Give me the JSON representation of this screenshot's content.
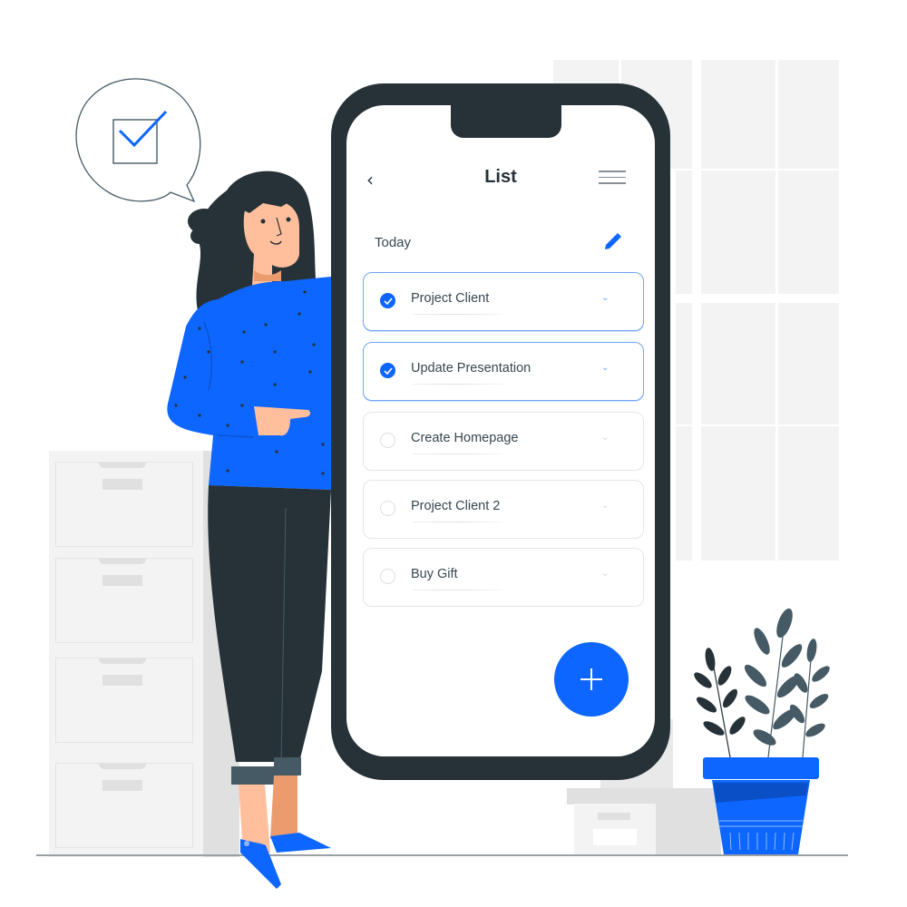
{
  "app": {
    "header": {
      "back_icon": "chevron-left-icon",
      "back_glyph": "‹",
      "title": "List",
      "menu_icon": "hamburger-menu-icon"
    },
    "section": {
      "label": "Today",
      "edit_icon": "pencil-icon"
    },
    "tasks": [
      {
        "label": "Project Client",
        "completed": true
      },
      {
        "label": "Update Presentation",
        "completed": true
      },
      {
        "label": "Create Homepage",
        "completed": false
      },
      {
        "label": "Project Client 2",
        "completed": false
      },
      {
        "label": "Buy Gift",
        "completed": false
      }
    ],
    "chevron_glyph": "⌄",
    "fab": {
      "icon": "plus-icon",
      "action": "add-task"
    }
  },
  "illustration": {
    "speech_bubble_icon": "checkbox-checked-icon",
    "person": "woman-pointing-at-phone",
    "plant": "potted-plant",
    "cabinet": "filing-cabinet",
    "window": "background-window"
  },
  "colors": {
    "accent": "#0d66ff",
    "phone_frame": "#263238",
    "text": "#37474f",
    "background_gray": "#f3f3f3"
  }
}
